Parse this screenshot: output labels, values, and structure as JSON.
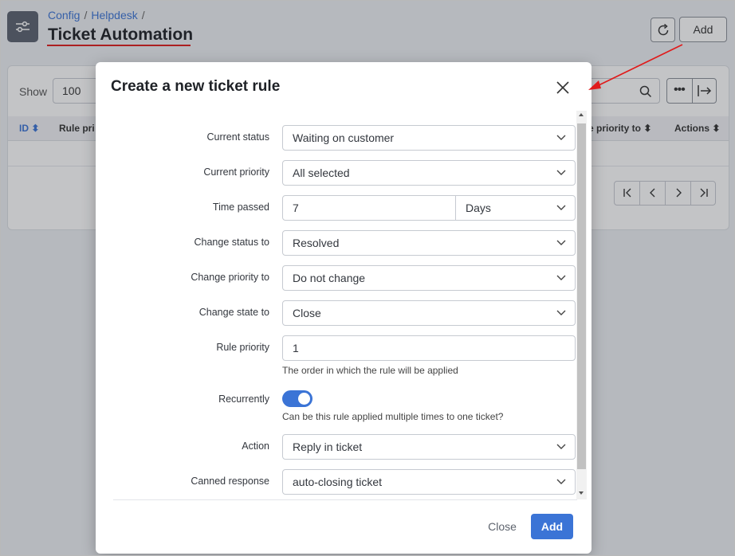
{
  "header": {
    "breadcrumb": [
      "Config",
      "Helpdesk"
    ],
    "title": "Ticket Automation",
    "add_label": "Add"
  },
  "table": {
    "show_label": "Show",
    "page_size": "100",
    "columns": [
      "ID",
      "Rule pri",
      "e priority to",
      "Actions"
    ]
  },
  "modal": {
    "title": "Create a new ticket rule",
    "fields": {
      "current_status": {
        "label": "Current status",
        "value": "Waiting on customer"
      },
      "current_priority": {
        "label": "Current priority",
        "value": "All selected"
      },
      "time_passed": {
        "label": "Time passed",
        "value": "7",
        "unit": "Days"
      },
      "change_status": {
        "label": "Change status to",
        "value": "Resolved"
      },
      "change_priority": {
        "label": "Change priority to",
        "value": "Do not change"
      },
      "change_state": {
        "label": "Change state to",
        "value": "Close"
      },
      "rule_priority": {
        "label": "Rule priority",
        "value": "1",
        "help": "The order in which the rule will be applied"
      },
      "recurrently": {
        "label": "Recurrently",
        "enabled": true,
        "help": "Can be this rule applied multiple times to one ticket?"
      },
      "action": {
        "label": "Action",
        "value": "Reply in ticket"
      },
      "canned_response": {
        "label": "Canned response",
        "value": "auto-closing ticket"
      }
    },
    "close_label": "Close",
    "add_label": "Add"
  },
  "colors": {
    "accent": "#3b74d6",
    "annotation": "#e01b1b"
  }
}
